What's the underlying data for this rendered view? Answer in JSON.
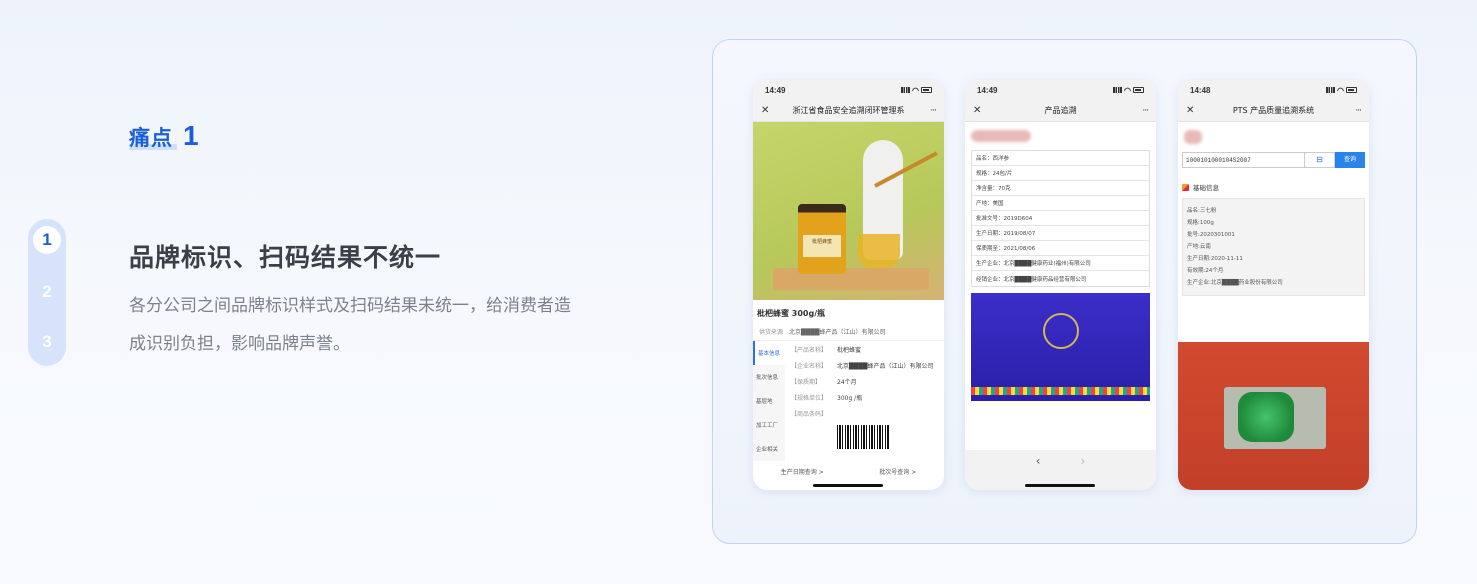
{
  "heading": {
    "label": "痛点",
    "number": "1"
  },
  "steps": [
    "1",
    "2",
    "3"
  ],
  "title": "品牌标识、扫码结果不统一",
  "description": "各分公司之间品牌标识样式及扫码结果未统一，给消费者造成识别负担，影响品牌声誉。",
  "phone1": {
    "time": "14:49",
    "nav_title": "浙江省食品安全追溯闭环管理系",
    "product_name": "枇杷蜂蜜 300g/瓶",
    "jar_label": "枇杷蜂蜜",
    "supply_label": "供货来源",
    "supply_value": "北京████蜂产品（江山）有限公司",
    "tabs": [
      "基本信息",
      "批次信息",
      "基层地",
      "加工工厂",
      "企业相关"
    ],
    "rows": [
      {
        "k": "【产品名称】",
        "v": "枇杷蜂蜜"
      },
      {
        "k": "【企业名称】",
        "v": "北京████蜂产品（江山）有限公司"
      },
      {
        "k": "【保质期】",
        "v": "24个月"
      },
      {
        "k": "【规格单位】",
        "v": "300g /瓶"
      },
      {
        "k": "【商品条码】",
        "v": ""
      }
    ],
    "bottom_left": "生产日期查询 >",
    "bottom_right": "批次号查询 >"
  },
  "phone2": {
    "time": "14:49",
    "nav_title": "产品追溯",
    "rows": [
      "品名：西洋参",
      "规格：24包/片",
      "净含量：70克",
      "产地：美国",
      "批准文号：2019D604",
      "生产日期：2019/08/07",
      "保质期至：2021/08/06",
      "生产企业：北京████健康药业(福州)有限公司",
      "经销企业：北京████健康药品经营有限公司"
    ]
  },
  "phone3": {
    "time": "14:48",
    "nav_title": "PTS 产品质量追溯系统",
    "code": "1000101000104S2007",
    "query_label": "查询",
    "section_title": "基础信息",
    "info": [
      "品名:三七粉",
      "规格:100g",
      "批号:2020301001",
      "产地:云南",
      "生产日期:2020-11-11",
      "有效期:24个月",
      "生产企业:北京████药业股份有限公司"
    ]
  }
}
